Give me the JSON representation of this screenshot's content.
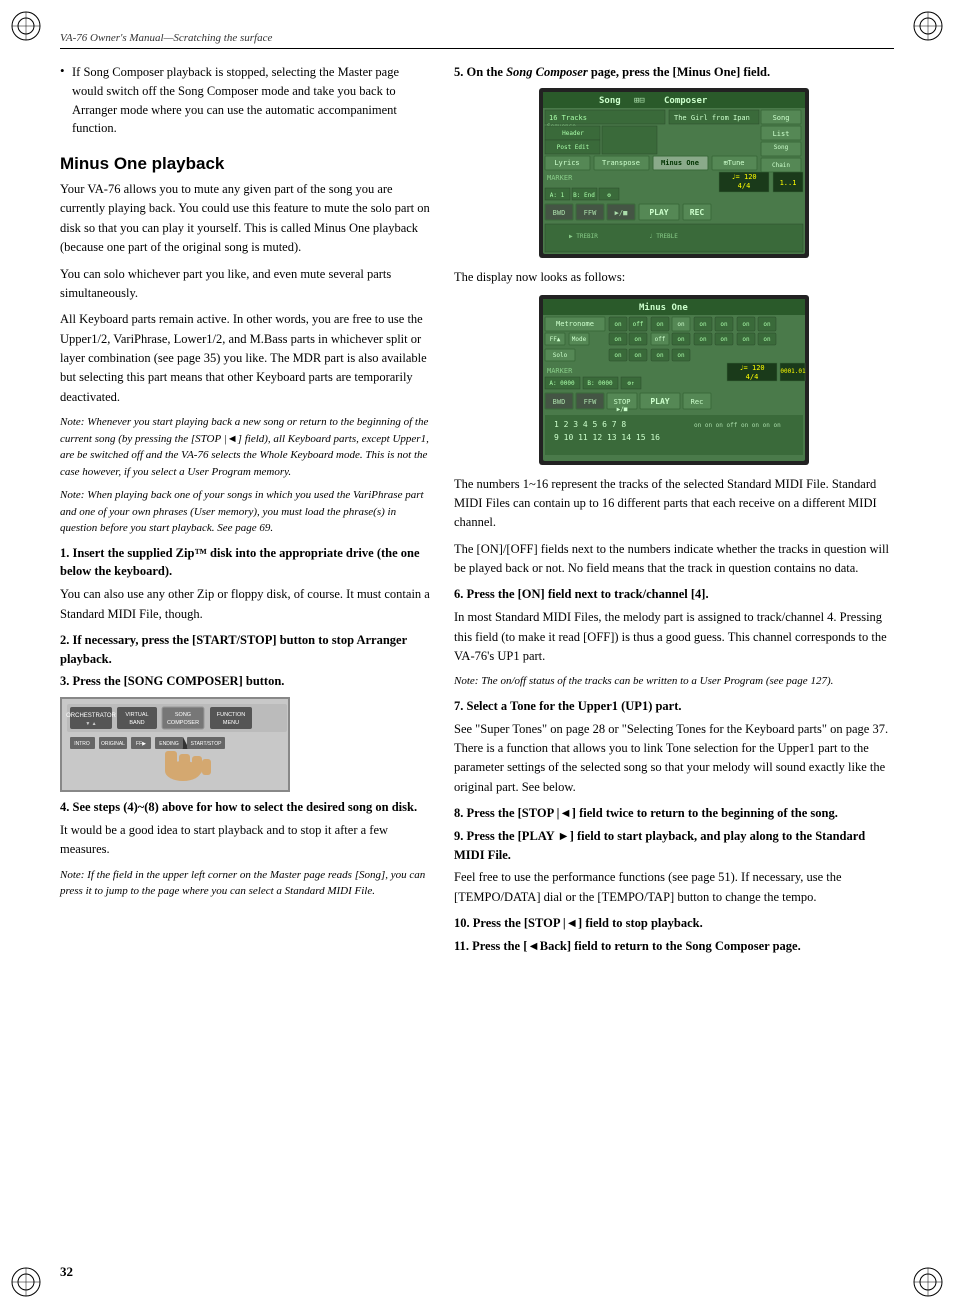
{
  "header": {
    "left": "VA-76 Owner's Manual",
    "right": "Scratching the surface",
    "separator": "—"
  },
  "page_number": "32",
  "left_col": {
    "bullet": {
      "text": "If Song Composer playback is stopped, selecting the Master page would switch off the Song Composer mode and take you back to Arranger mode where you can use the automatic accompaniment function."
    },
    "section_heading": "Minus One playback",
    "paragraphs": [
      "Your VA-76 allows you to mute any given part of the song you are currently playing back. You could use this feature to mute the solo part on disk so that you can play it yourself. This is called Minus One playback (because one part of the original song is muted).",
      "You can solo whichever part you like, and even mute several parts simultaneously.",
      "All Keyboard parts remain active. In other words, you are free to use the Upper1/2, VariPhrase, Lower1/2, and M.Bass parts in whichever split or layer combination (see page 35) you like. The MDR part is also available but selecting this part means that other Keyboard parts are temporarily deactivated."
    ],
    "notes": [
      "Note: Whenever you start playing back a new song or return to the beginning of the current song (by pressing the [STOP    |◄] field), all Keyboard parts, except Upper1, are be switched off and the VA-76 selects the Whole Keyboard mode. This is not the case however, if you select a User Program memory.",
      "Note: When playing back one of your songs in which you used the VariPhrase part and one of your own phrases (User memory), you must load the phrase(s) in question before you start playback. See page 69."
    ],
    "steps_left": [
      {
        "number": "1",
        "heading": "Insert the supplied Zip™ disk into the appropriate drive (the one below the keyboard).",
        "body": "You can also use any other Zip or floppy disk, of course. It must contain a Standard MIDI File, though."
      },
      {
        "number": "2",
        "heading": "If necessary, press the [START/STOP] button to stop Arranger playback."
      },
      {
        "number": "3",
        "heading": "Press the [SONG COMPOSER] button."
      }
    ],
    "step4_heading": "4. See steps (4)~(8) above for how to select the desired song on disk.",
    "step4_body": "It would be a good idea to start playback and to stop it after a few measures.",
    "step4_note": "Note: If the field in the upper left corner on the Master page reads [Song], you can press it to jump to the page where you can select a Standard MIDI File."
  },
  "right_col": {
    "step5": {
      "heading": "5. On the Song Composer page, press the [Minus One] field.",
      "caption": "The display now looks as follows:"
    },
    "description_paras": [
      "The numbers 1~16 represent the tracks of the selected Standard MIDI File. Standard MIDI Files can contain up to 16 different parts that each receive on a different MIDI channel.",
      "The [ON]/[OFF] fields next to the numbers indicate whether the tracks in question will be played back or not. No field means that the track in question contains no data."
    ],
    "steps_right": [
      {
        "number": "6",
        "heading": "Press the [ON] field next to track/channel [4].",
        "body": "In most Standard MIDI Files, the melody part is assigned to track/channel 4. Pressing this field (to make it read [OFF]) is thus a good guess. This channel corresponds to the VA-76's UP1 part.",
        "note": "Note: The on/off status of the tracks can be written to a User Program (see page 127)."
      },
      {
        "number": "7",
        "heading": "Select a Tone for the Upper1 (UP1) part.",
        "body": "See \"Super Tones\" on page 28 or \"Selecting Tones for the Keyboard parts\" on page 37. There is a function that allows you to link Tone selection for the Upper1 part to the parameter settings of the selected song so that your melody will sound exactly like the original part. See below."
      },
      {
        "number": "8",
        "heading": "Press the [STOP    |◄] field twice to return to the beginning of the song."
      },
      {
        "number": "9",
        "heading": "Press the [PLAY ►] field to start playback, and play along to the Standard MIDI File.",
        "body": "Feel free to use the performance functions (see page 51). If necessary, use the [TEMPO/DATA] dial or the [TEMPO/TAP] button to change the tempo."
      },
      {
        "number": "10",
        "heading": "Press the [STOP    |◄] field to stop playback."
      },
      {
        "number": "11",
        "heading": "Press the [◄Back] field to return to the Song Composer page."
      }
    ]
  }
}
